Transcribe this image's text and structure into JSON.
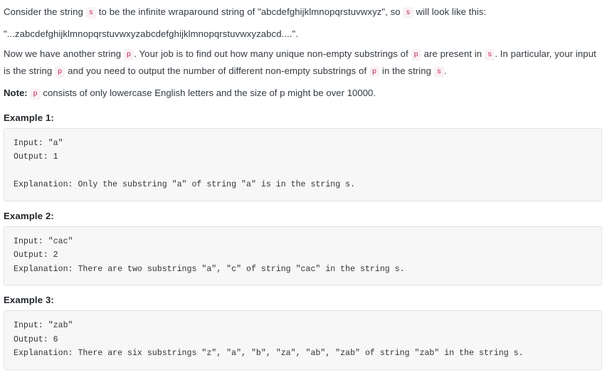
{
  "document": {
    "type": "problem-description",
    "paragraphs": [
      {
        "id": "intro",
        "segments": [
          {
            "kind": "text",
            "value": "Consider the string "
          },
          {
            "kind": "code",
            "value": "s"
          },
          {
            "kind": "text",
            "value": " to be the infinite wraparound string of \"abcdefghijklmnopqrstuvwxyz\", so "
          },
          {
            "kind": "code",
            "value": "s"
          },
          {
            "kind": "text",
            "value": " will look like this:"
          }
        ]
      },
      {
        "id": "wraparound-example",
        "segments": [
          {
            "kind": "text",
            "value": "\"...zabcdefghijklmnopqrstuvwxyzabcdefghijklmnopqrstuvwxyzabcd....\"."
          }
        ]
      },
      {
        "id": "task",
        "segments": [
          {
            "kind": "text",
            "value": "Now we have another string "
          },
          {
            "kind": "code",
            "value": "p"
          },
          {
            "kind": "text",
            "value": ". Your job is to find out how many unique non-empty substrings of "
          },
          {
            "kind": "code",
            "value": "p"
          },
          {
            "kind": "text",
            "value": " are present in "
          },
          {
            "kind": "code",
            "value": "s"
          },
          {
            "kind": "text",
            "value": ". In particular, your input is the string "
          },
          {
            "kind": "code",
            "value": "p"
          },
          {
            "kind": "text",
            "value": " and you need to output the number of different non-empty substrings of "
          },
          {
            "kind": "code",
            "value": "p"
          },
          {
            "kind": "text",
            "value": " in the string "
          },
          {
            "kind": "code",
            "value": "s"
          },
          {
            "kind": "text",
            "value": "."
          }
        ]
      },
      {
        "id": "note",
        "segments": [
          {
            "kind": "bold",
            "value": "Note:"
          },
          {
            "kind": "text",
            "value": " "
          },
          {
            "kind": "code",
            "value": "p"
          },
          {
            "kind": "text",
            "value": " consists of only lowercase English letters and the size of p might be over 10000."
          }
        ]
      }
    ],
    "examples": [
      {
        "title": "Example 1:",
        "code": "Input: \"a\"\nOutput: 1\n\nExplanation: Only the substring \"a\" of string \"a\" is in the string s."
      },
      {
        "title": "Example 2:",
        "code": "Input: \"cac\"\nOutput: 2\nExplanation: There are two substrings \"a\", \"c\" of string \"cac\" in the string s."
      },
      {
        "title": "Example 3:",
        "code": "Input: \"zab\"\nOutput: 6\nExplanation: There are six substrings \"z\", \"a\", \"b\", \"za\", \"ab\", \"zab\" of string \"zab\" in the string s."
      }
    ]
  },
  "theme": {
    "page_background": "#ffffff",
    "text_color": "#333a42",
    "heading_color": "#1f2429",
    "inline_code_color": "#c7254e",
    "inline_code_background": "#f9f2f4",
    "code_block_background": "#f7f7f7",
    "code_block_border": "#e3e3e3"
  }
}
